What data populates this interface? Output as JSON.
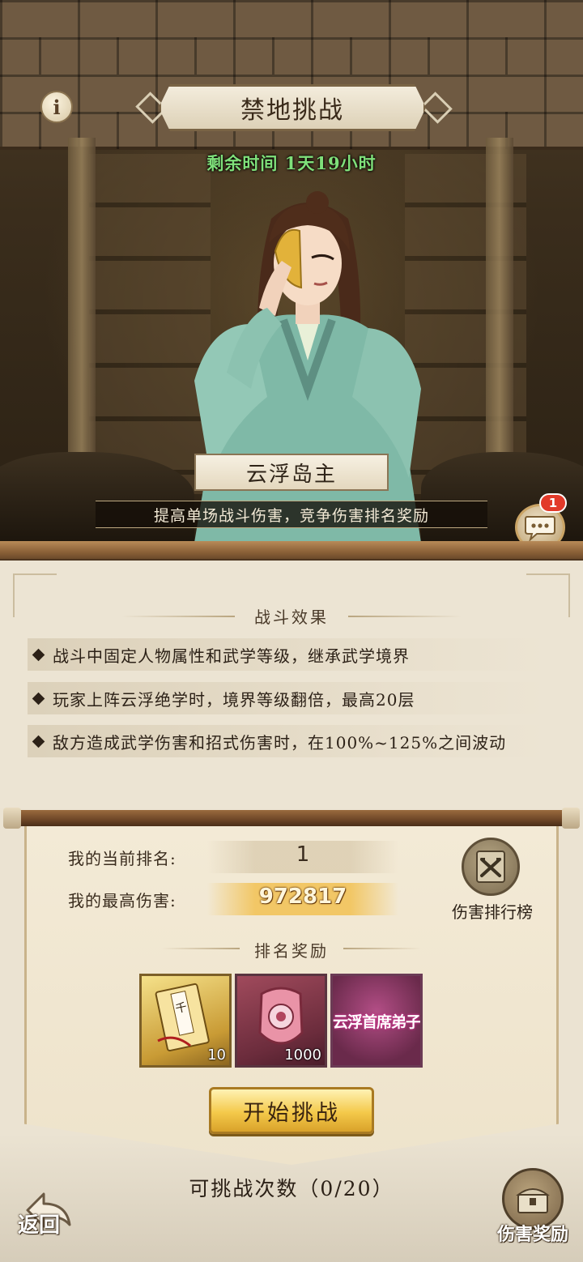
{
  "header": {
    "title": "禁地挑战",
    "remaining_time": "剩余时间 1天19小时",
    "info_icon": "info-icon"
  },
  "boss": {
    "name": "云浮岛主",
    "description": "提高单场战斗伤害，竞争伤害排名奖励"
  },
  "chat": {
    "badge_count": "1",
    "icon": "chat-bubble-icon"
  },
  "battle_effects": {
    "title": "战斗效果",
    "items": [
      "战斗中固定人物属性和武学等级，继承武学境界",
      "玩家上阵云浮绝学时，境界等级翻倍，最高20层",
      "敌方造成武学伤害和招式伤害时，在100%~125%之间波动"
    ]
  },
  "ranking": {
    "current_rank_label": "我的当前排名:",
    "current_rank_value": "1",
    "max_damage_label": "我的最高伤害:",
    "max_damage_value": "972817",
    "leaderboard_label": "伤害排行榜",
    "rewards_title": "排名奖励",
    "rewards": [
      {
        "icon": "scroll-book-icon",
        "count": "10",
        "style": "gold"
      },
      {
        "icon": "armor-token-icon",
        "count": "1000",
        "style": "red"
      },
      {
        "icon": "title-badge-icon",
        "text": "云浮首席弟子",
        "style": "pink"
      }
    ]
  },
  "actions": {
    "start_label": "开始挑战",
    "attempts_label": "可挑战次数（0/20）",
    "back_label": "返回",
    "damage_reward_label": "伤害奖励"
  },
  "colors": {
    "timer_green": "#7fe07a",
    "damage_gold": "#f2c766",
    "button_gold": "#f4c94a",
    "badge_red": "#e23a2a"
  }
}
